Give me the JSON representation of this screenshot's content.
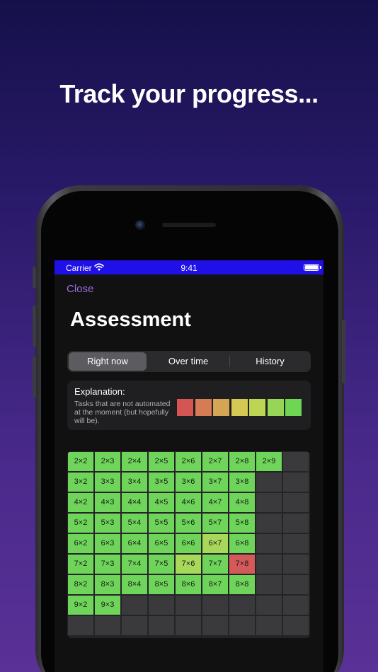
{
  "headline": "Track your progress...",
  "status_bar": {
    "carrier": "Carrier",
    "time": "9:41"
  },
  "nav": {
    "close_label": "Close"
  },
  "page_title": "Assessment",
  "segments": [
    {
      "label": "Right now",
      "active": true
    },
    {
      "label": "Over time",
      "active": false
    },
    {
      "label": "History",
      "active": false
    }
  ],
  "explanation": {
    "title": "Explanation:",
    "text": "Tasks that are not automated at the moment (but hopefully will be).",
    "scale_colors": [
      "#d55555",
      "#d57c55",
      "#d5a455",
      "#d5c955",
      "#bdd555",
      "#96d555",
      "#6ed555"
    ]
  },
  "colors": {
    "good": "#6ed55a",
    "partial": "#a8d85a",
    "bad": "#d45a5a",
    "empty": "#3a3a3c",
    "accent": "#9a6ee0",
    "status_bar": "#1f10e8"
  },
  "grid": {
    "rows": [
      [
        {
          "t": "2×2",
          "s": "good"
        },
        {
          "t": "2×3",
          "s": "good"
        },
        {
          "t": "2×4",
          "s": "good"
        },
        {
          "t": "2×5",
          "s": "good"
        },
        {
          "t": "2×6",
          "s": "good"
        },
        {
          "t": "2×7",
          "s": "good"
        },
        {
          "t": "2×8",
          "s": "good"
        },
        {
          "t": "2×9",
          "s": "good"
        },
        {
          "t": "",
          "s": "empty"
        }
      ],
      [
        {
          "t": "3×2",
          "s": "good"
        },
        {
          "t": "3×3",
          "s": "good"
        },
        {
          "t": "3×4",
          "s": "good"
        },
        {
          "t": "3×5",
          "s": "good"
        },
        {
          "t": "3×6",
          "s": "good"
        },
        {
          "t": "3×7",
          "s": "good"
        },
        {
          "t": "3×8",
          "s": "good"
        },
        {
          "t": "",
          "s": "empty"
        },
        {
          "t": "",
          "s": "empty"
        }
      ],
      [
        {
          "t": "4×2",
          "s": "good"
        },
        {
          "t": "4×3",
          "s": "good"
        },
        {
          "t": "4×4",
          "s": "good"
        },
        {
          "t": "4×5",
          "s": "good"
        },
        {
          "t": "4×6",
          "s": "good"
        },
        {
          "t": "4×7",
          "s": "good"
        },
        {
          "t": "4×8",
          "s": "good"
        },
        {
          "t": "",
          "s": "empty"
        },
        {
          "t": "",
          "s": "empty"
        }
      ],
      [
        {
          "t": "5×2",
          "s": "good"
        },
        {
          "t": "5×3",
          "s": "good"
        },
        {
          "t": "5×4",
          "s": "good"
        },
        {
          "t": "5×5",
          "s": "good"
        },
        {
          "t": "5×6",
          "s": "good"
        },
        {
          "t": "5×7",
          "s": "good"
        },
        {
          "t": "5×8",
          "s": "good"
        },
        {
          "t": "",
          "s": "empty"
        },
        {
          "t": "",
          "s": "empty"
        }
      ],
      [
        {
          "t": "6×2",
          "s": "good"
        },
        {
          "t": "6×3",
          "s": "good"
        },
        {
          "t": "6×4",
          "s": "good"
        },
        {
          "t": "6×5",
          "s": "good"
        },
        {
          "t": "6×6",
          "s": "good"
        },
        {
          "t": "6×7",
          "s": "partial"
        },
        {
          "t": "6×8",
          "s": "good"
        },
        {
          "t": "",
          "s": "empty"
        },
        {
          "t": "",
          "s": "empty"
        }
      ],
      [
        {
          "t": "7×2",
          "s": "good"
        },
        {
          "t": "7×3",
          "s": "good"
        },
        {
          "t": "7×4",
          "s": "good"
        },
        {
          "t": "7×5",
          "s": "good"
        },
        {
          "t": "7×6",
          "s": "partial"
        },
        {
          "t": "7×7",
          "s": "good"
        },
        {
          "t": "7×8",
          "s": "bad"
        },
        {
          "t": "",
          "s": "empty"
        },
        {
          "t": "",
          "s": "empty"
        }
      ],
      [
        {
          "t": "8×2",
          "s": "good"
        },
        {
          "t": "8×3",
          "s": "good"
        },
        {
          "t": "8×4",
          "s": "good"
        },
        {
          "t": "8×5",
          "s": "good"
        },
        {
          "t": "8×6",
          "s": "good"
        },
        {
          "t": "8×7",
          "s": "good"
        },
        {
          "t": "8×8",
          "s": "good"
        },
        {
          "t": "",
          "s": "empty"
        },
        {
          "t": "",
          "s": "empty"
        }
      ],
      [
        {
          "t": "9×2",
          "s": "good"
        },
        {
          "t": "9×3",
          "s": "good"
        },
        {
          "t": "",
          "s": "empty"
        },
        {
          "t": "",
          "s": "empty"
        },
        {
          "t": "",
          "s": "empty"
        },
        {
          "t": "",
          "s": "empty"
        },
        {
          "t": "",
          "s": "empty"
        },
        {
          "t": "",
          "s": "empty"
        },
        {
          "t": "",
          "s": "empty"
        }
      ],
      [
        {
          "t": "",
          "s": "empty"
        },
        {
          "t": "",
          "s": "empty"
        },
        {
          "t": "",
          "s": "empty"
        },
        {
          "t": "",
          "s": "empty"
        },
        {
          "t": "",
          "s": "empty"
        },
        {
          "t": "",
          "s": "empty"
        },
        {
          "t": "",
          "s": "empty"
        },
        {
          "t": "",
          "s": "empty"
        },
        {
          "t": "",
          "s": "empty"
        }
      ]
    ]
  }
}
